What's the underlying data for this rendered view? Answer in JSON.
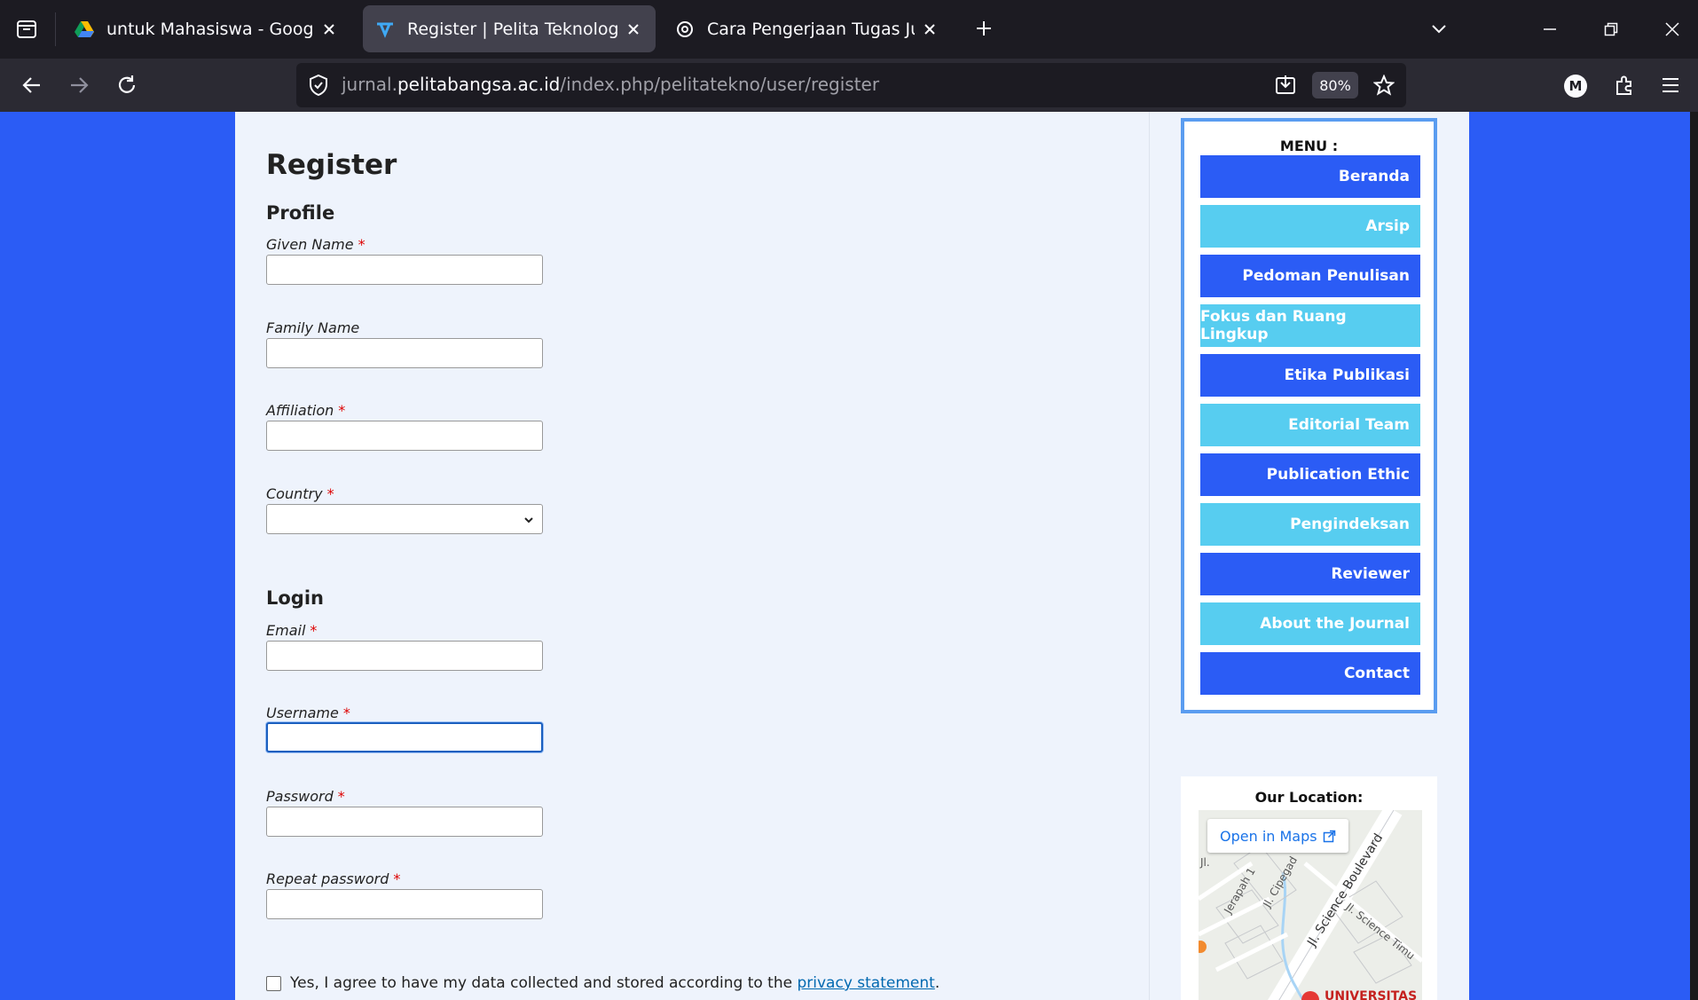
{
  "browser": {
    "tabs": [
      {
        "title": "untuk Mahasiswa - Google Drive",
        "favicon": "google-drive-icon",
        "active": false
      },
      {
        "title": "Register | Pelita Teknologi",
        "favicon": "pelita-journal-icon",
        "active": true
      },
      {
        "title": "Cara Pengerjaan Tugas Jurnal",
        "favicon": "chatgpt-icon",
        "active": false
      }
    ],
    "url": {
      "prefix": "jurnal.",
      "domain": "pelitabangsa.ac.id",
      "path": "/index.php/pelitatekno/user/register"
    },
    "zoom": "80%",
    "account_initial": "M"
  },
  "form": {
    "title": "Register",
    "profile_heading": "Profile",
    "login_heading": "Login",
    "fields": {
      "given_name": {
        "label": "Given Name",
        "required": "*",
        "value": ""
      },
      "family_name": {
        "label": "Family Name",
        "value": ""
      },
      "affiliation": {
        "label": "Affiliation",
        "required": "*",
        "value": ""
      },
      "country": {
        "label": "Country",
        "required": "*",
        "value": ""
      },
      "email": {
        "label": "Email",
        "required": "*",
        "value": ""
      },
      "username": {
        "label": "Username",
        "required": "*",
        "value": ""
      },
      "password": {
        "label": "Password",
        "required": "*",
        "value": ""
      },
      "repeat_password": {
        "label": "Repeat password",
        "required": "*",
        "value": ""
      }
    },
    "consent": {
      "text": "Yes, I agree to have my data collected and stored according to the ",
      "link": "privacy statement",
      "suffix": ".",
      "checked": false
    }
  },
  "sidebar": {
    "menu_heading": "MENU :",
    "menu_items": [
      {
        "label": "Beranda"
      },
      {
        "label": "Arsip"
      },
      {
        "label": "Pedoman Penulisan"
      },
      {
        "label": "Fokus dan Ruang Lingkup"
      },
      {
        "label": "Etika Publikasi"
      },
      {
        "label": "Editorial Team"
      },
      {
        "label": "Publication Ethic"
      },
      {
        "label": "Pengindeksan"
      },
      {
        "label": "Reviewer"
      },
      {
        "label": "About the Journal"
      },
      {
        "label": "Contact"
      }
    ],
    "location": {
      "heading": "Our Location:",
      "open_maps": "Open in Maps",
      "street_main": "Jl. Science Boulevard",
      "street_2": "Jl. Science Timu",
      "street_3": "Jl. Cipegad",
      "street_4": "Jerapah 1",
      "street_5": "Jl.",
      "pin_label": "UNIVERSITAS"
    }
  },
  "colors": {
    "page_bg": "#2b5cf5",
    "menu_dark": "#2b5cf5",
    "menu_light": "#57cdf0",
    "required": "#dd0000",
    "link": "#0068b0"
  }
}
